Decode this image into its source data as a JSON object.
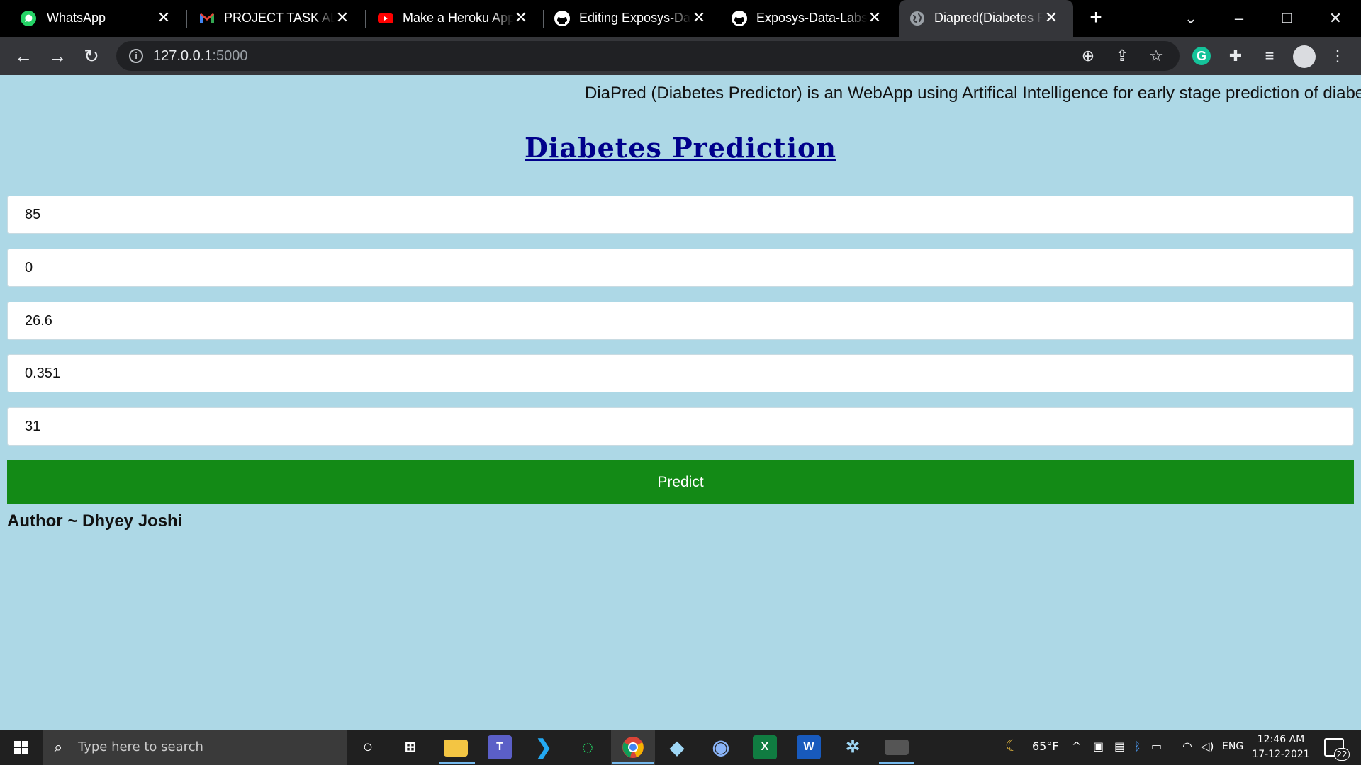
{
  "browser": {
    "tabs": [
      {
        "title": "WhatsApp",
        "icon": "whatsapp-icon",
        "active": false
      },
      {
        "title": "PROJECT TASK ALLOCATION",
        "icon": "gmail-icon",
        "active": false
      },
      {
        "title": "Make a Heroku App",
        "icon": "youtube-icon",
        "active": false
      },
      {
        "title": "Editing Exposys-Data",
        "icon": "github-icon",
        "active": false
      },
      {
        "title": "Exposys-Data-Labs-In",
        "icon": "github-icon",
        "active": false
      },
      {
        "title": "Diapred(Diabetes Predictor)",
        "icon": "globe-icon",
        "active": true
      }
    ],
    "new_tab_glyph": "+",
    "address": {
      "host": "127.0.0.1",
      "port": ":5000"
    }
  },
  "page": {
    "marquee_text": "DiaPred (Diabetes Predictor) is an WebApp using Artifical Intelligence for early stage prediction of diabetes",
    "heading": "Diabetes Prediction",
    "inputs": [
      {
        "value": "85"
      },
      {
        "value": "0"
      },
      {
        "value": "26.6"
      },
      {
        "value": "0.351"
      },
      {
        "value": "31"
      }
    ],
    "predict_label": "Predict",
    "author": "Author ~ Dhyey Joshi"
  },
  "taskbar": {
    "search_placeholder": "Type here to search",
    "weather": "65°F",
    "language": "ENG",
    "time": "12:46 AM",
    "date": "17-12-2021",
    "notification_count": "22"
  },
  "colors": {
    "page_bg": "#add8e6",
    "heading": "#00008b",
    "predict_button": "#138a16"
  }
}
